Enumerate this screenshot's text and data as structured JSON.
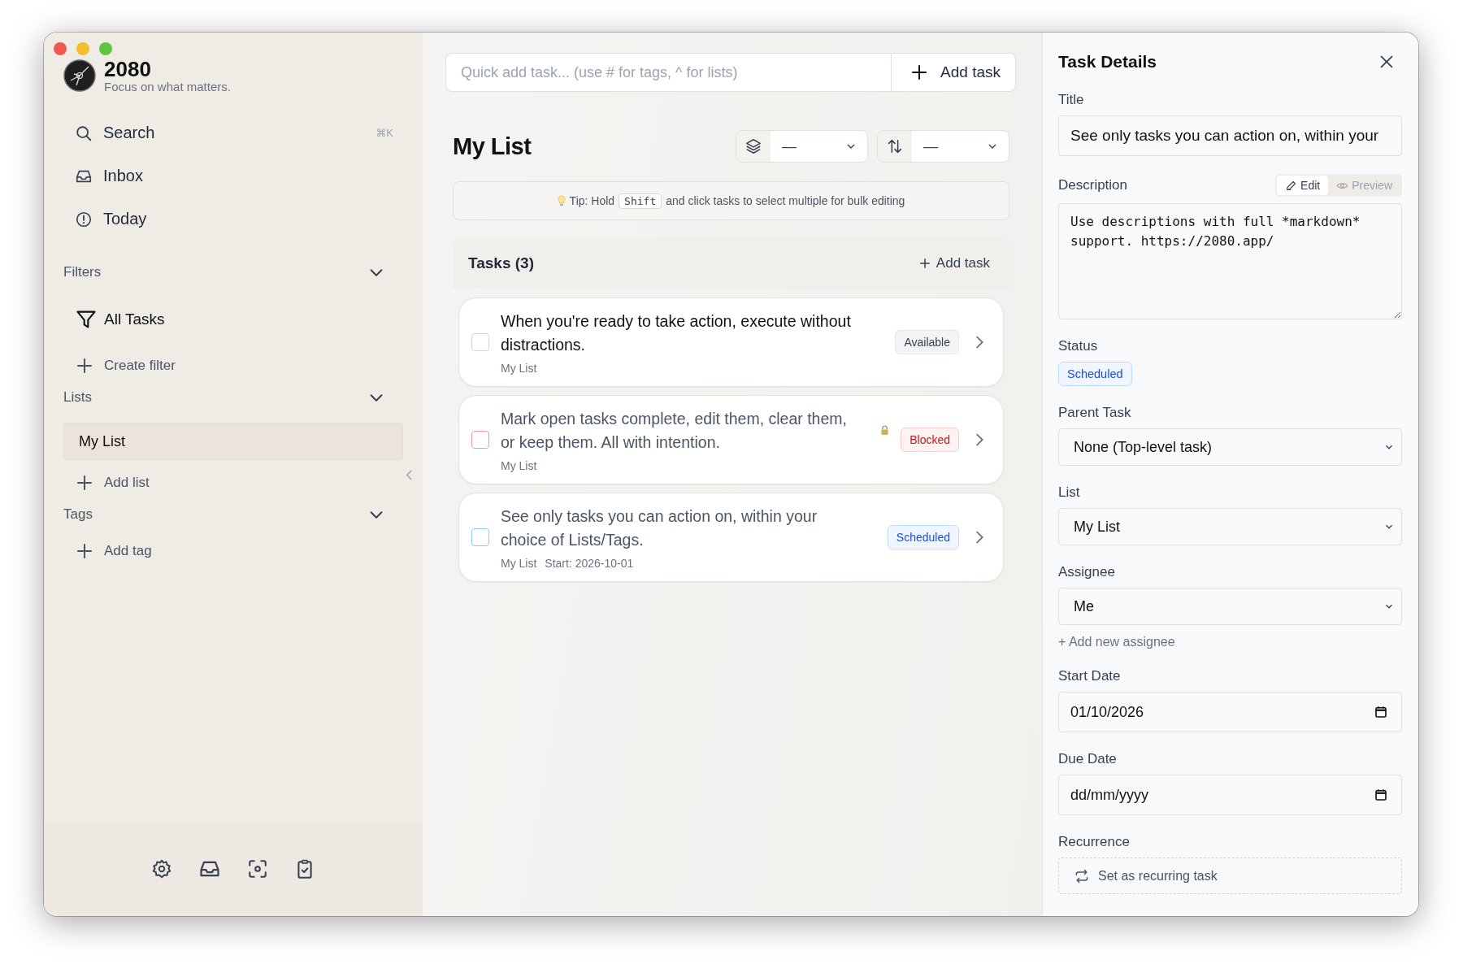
{
  "app": {
    "name": "2080",
    "tagline": "Focus on what matters."
  },
  "nav": [
    {
      "kind": "search",
      "label": "Search",
      "shortcut": "⌘K"
    },
    {
      "kind": "inbox",
      "label": "Inbox"
    },
    {
      "kind": "today",
      "label": "Today"
    }
  ],
  "sections": [
    {
      "title": "Filters",
      "expanded": true,
      "items": [
        {
          "kind": "filter",
          "label": "All Tasks",
          "selected": false
        }
      ],
      "add_label": "Create filter"
    },
    {
      "title": "Lists",
      "expanded": true,
      "items": [
        {
          "kind": "list",
          "label": "My List",
          "selected": true
        }
      ],
      "add_label": "Add list"
    },
    {
      "title": "Tags",
      "expanded": true,
      "add_label": "Add tag"
    }
  ],
  "quick_add": {
    "placeholder": "Quick add task... (use # for tags, ^ for lists)",
    "button": "Add task"
  },
  "list_title": "My List",
  "group_select": {
    "value": "—"
  },
  "sort_select": {
    "value": "—"
  },
  "tip": {
    "before": "Tip: Hold",
    "key": "Shift",
    "after": "and click tasks to select multiple for bulk editing"
  },
  "tasks_panel": {
    "heading": "Tasks (3)",
    "add_label": "Add task"
  },
  "tasks": [
    {
      "title": "When you're ready to take action, execute without distractions.",
      "list": "My List",
      "status": {
        "kind": "available",
        "label": "Available"
      },
      "locked": false,
      "checked": false
    },
    {
      "title": "Mark open tasks complete, edit them, clear them, or keep them. All with intention.",
      "list": "My List",
      "status": {
        "kind": "blocked",
        "label": "Blocked"
      },
      "locked": true,
      "checked": false
    },
    {
      "title": "See only tasks you can action on, within your choice of Lists/Tags.",
      "list": "My List",
      "start": "Start: 2026-10-01",
      "status": {
        "kind": "scheduled",
        "label": "Scheduled"
      },
      "locked": false,
      "checked": false
    }
  ],
  "details": {
    "heading": "Task Details",
    "fields": [
      {
        "kind": "text",
        "label": "Title",
        "value": "See only tasks you can action on, within your"
      },
      {
        "kind": "markdown",
        "label": "Description",
        "value": "Use descriptions with full *markdown* support. https://2080.app/",
        "modes": [
          {
            "label": "Edit",
            "selected": true
          },
          {
            "label": "Preview",
            "selected": false
          }
        ]
      },
      {
        "kind": "status",
        "label": "Status",
        "status": {
          "kind": "scheduled",
          "label": "Scheduled"
        }
      },
      {
        "kind": "select",
        "label": "Parent Task",
        "value": "None (Top-level task)"
      },
      {
        "kind": "select",
        "label": "List",
        "value": "My List"
      },
      {
        "kind": "select",
        "label": "Assignee",
        "value": "Me",
        "link": "+ Add new assignee"
      },
      {
        "kind": "date",
        "label": "Start Date",
        "value": "01/10/2026"
      },
      {
        "kind": "date",
        "label": "Due Date",
        "placeholder": "dd/mm/yyyy"
      },
      {
        "kind": "recurrence",
        "label": "Recurrence",
        "button": "Set as recurring task"
      }
    ]
  }
}
